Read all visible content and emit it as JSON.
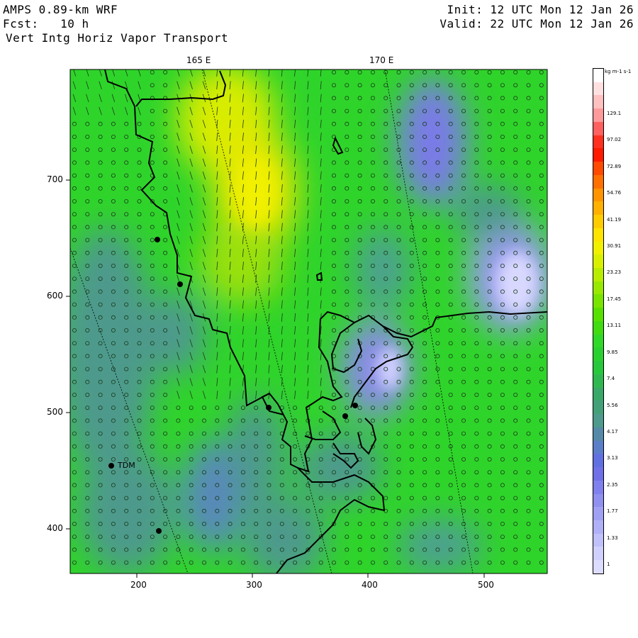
{
  "header": {
    "model": "AMPS 0.89-km WRF",
    "forecast": "Fcst:   10 h",
    "field": "Vert Intg Horiz Vapor Transport",
    "init": "Init: 12 UTC Mon 12 Jan 26",
    "valid": "Valid: 22 UTC Mon 12 Jan 26"
  },
  "map": {
    "lon_labels": [
      "165 E",
      "170 E"
    ],
    "x_ticks": [
      "200",
      "300",
      "400",
      "500"
    ],
    "y_ticks": [
      "700",
      "600",
      "500",
      "400"
    ],
    "station_label": "TDM"
  },
  "colorbar": {
    "units": "kg m-1 s-1",
    "labels": [
      "129.1",
      "97.02",
      "72.89",
      "54.76",
      "41.19",
      "30.91",
      "23.23",
      "17.45",
      "13.11",
      "9.85",
      "7.4",
      "5.56",
      "4.17",
      "3.13",
      "2.35",
      "1.77",
      "1.33",
      "1"
    ],
    "colors": {
      "land_blue_grey": "#4e9a8c",
      "green": "#33e02a",
      "yellow": "#e8e800",
      "lavender": "#c8c8ff",
      "coast": "#000000"
    }
  }
}
